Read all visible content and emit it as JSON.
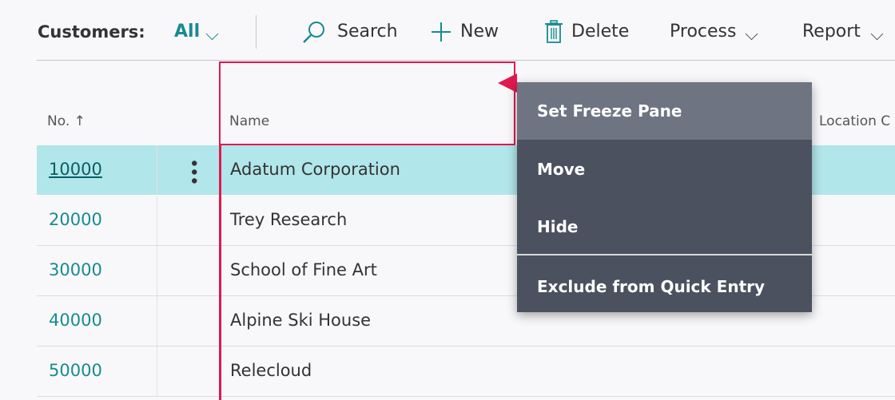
{
  "toolbar": {
    "title": "Customers:",
    "filter": "All",
    "actions": {
      "search": "Search",
      "new": "New",
      "delete": "Delete",
      "process": "Process",
      "report": "Report"
    }
  },
  "columns": {
    "no": "No. ↑",
    "name": "Name",
    "location": "Location C"
  },
  "rows": [
    {
      "no": "10000",
      "name": "Adatum Corporation"
    },
    {
      "no": "20000",
      "name": "Trey Research"
    },
    {
      "no": "30000",
      "name": "School of Fine Art"
    },
    {
      "no": "40000",
      "name": "Alpine Ski House"
    },
    {
      "no": "50000",
      "name": "Relecloud"
    }
  ],
  "context_menu": {
    "items": [
      "Set Freeze Pane",
      "Move",
      "Hide",
      "Exclude from Quick Entry"
    ]
  },
  "colors": {
    "accent": "#178a94",
    "selected_row": "#b1e6ea",
    "focus_border": "#e0194f",
    "menu_bg": "#4c5160",
    "menu_highlight": "#6e7482"
  }
}
